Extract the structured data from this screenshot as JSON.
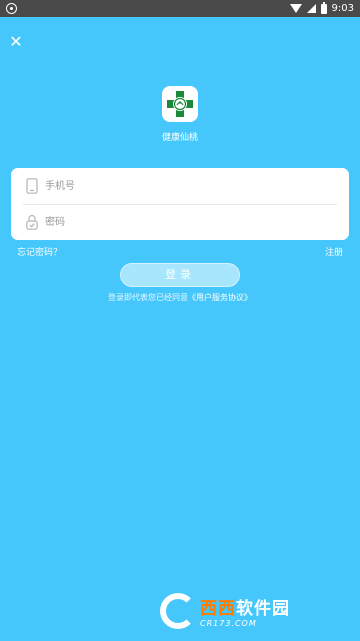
{
  "status_bar": {
    "time": "9:03"
  },
  "header": {
    "close_label": "✕"
  },
  "app": {
    "name": "健康仙桃",
    "logo_color": "#1a8a3a"
  },
  "form": {
    "phone_placeholder": "手机号",
    "password_placeholder": "密码"
  },
  "links": {
    "forgot_password": "忘记密码？",
    "register": "注册"
  },
  "login_button": {
    "label": "登录"
  },
  "agreement": {
    "prefix": "登录即代表您已经同意",
    "link": "《用户服务协议》"
  },
  "watermark": {
    "title_part1": "西西",
    "title_part2": "软件园",
    "url": "CR173.COM"
  },
  "colors": {
    "background": "#46c7fb",
    "status_bar": "#4a4a4a",
    "button_bg": "#a7e6fd",
    "watermark_orange": "#ff7b00"
  }
}
